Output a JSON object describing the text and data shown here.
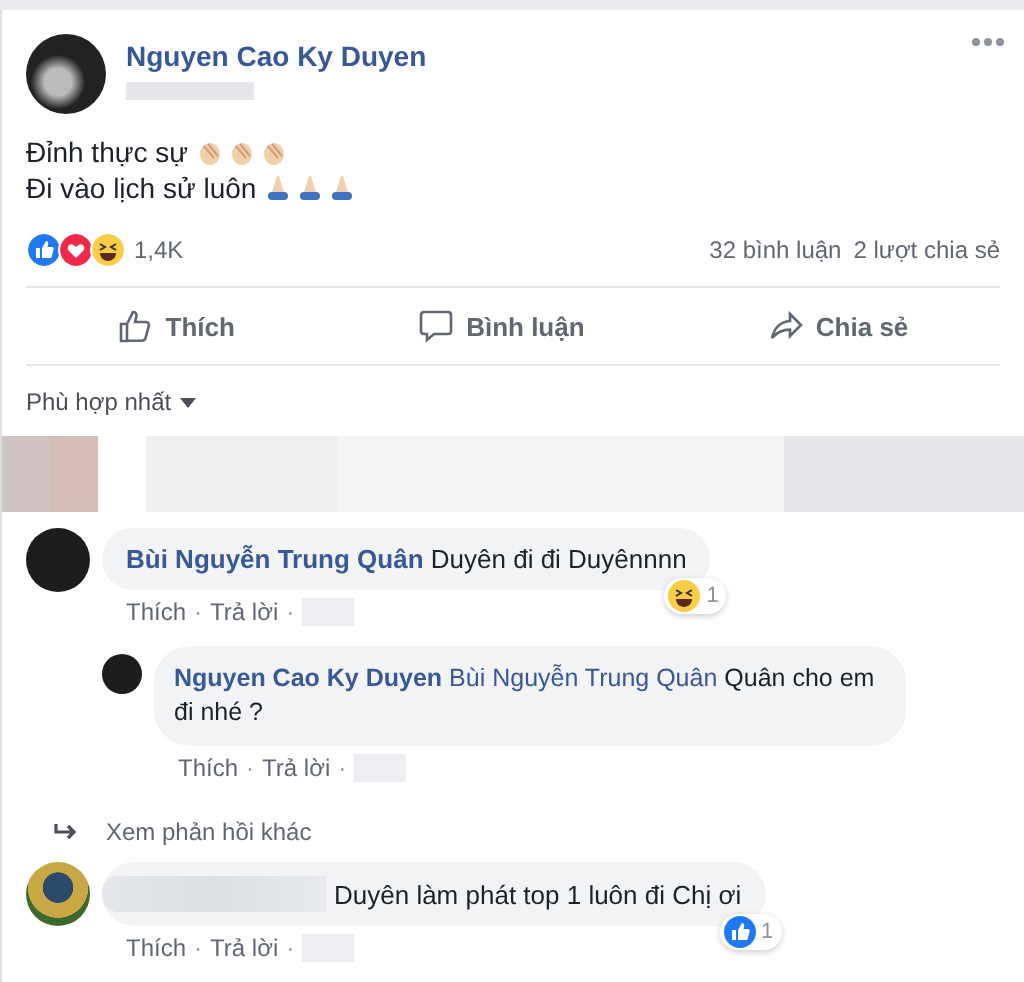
{
  "post": {
    "author": "Nguyen Cao Ky Duyen",
    "lines": [
      {
        "text": "Đỉnh thực sự",
        "emoji": [
          {
            "kind": "clap"
          },
          {
            "kind": "clap"
          },
          {
            "kind": "clap"
          }
        ]
      },
      {
        "text": "Đi vào lịch sử luôn",
        "emoji": [
          {
            "kind": "pray"
          },
          {
            "kind": "pray"
          },
          {
            "kind": "pray"
          }
        ]
      }
    ],
    "reactions": [
      {
        "kind": "like"
      },
      {
        "kind": "love"
      },
      {
        "kind": "haha"
      }
    ],
    "reaction_count": "1,4K",
    "comments_count": "32 bình luận",
    "shares_count": "2 lượt chia sẻ",
    "actions": [
      {
        "kind": "like",
        "label": "Thích"
      },
      {
        "kind": "comment",
        "label": "Bình luận"
      },
      {
        "kind": "share",
        "label": "Chia sẻ"
      }
    ]
  },
  "sort": {
    "label": "Phù hợp nhất"
  },
  "comments": [
    {
      "author": "Bùi Nguyễn Trung Quân",
      "kind": "named",
      "text": "Duyên đi đi Duyênnnn",
      "reaction": {
        "kind": "haha",
        "count": "1"
      },
      "actions": [
        "Thích",
        "Trả lời"
      ],
      "separator": "·",
      "replies": [
        {
          "author": "Nguyen Cao Ky Duyen",
          "mention": "Bùi Nguyễn Trung Quân",
          "text": "Quân cho em đi nhé ?",
          "actions": [
            "Thích",
            "Trả lời"
          ],
          "separator": "·"
        }
      ],
      "more_replies": "Xem phản hồi khác"
    },
    {
      "kind": "anonymous",
      "text": "Duyên làm phát top 1 luôn đi Chị ơi",
      "reaction": {
        "kind": "like",
        "count": "1"
      },
      "actions": [
        "Thích",
        "Trả lời"
      ],
      "separator": "·"
    }
  ]
}
